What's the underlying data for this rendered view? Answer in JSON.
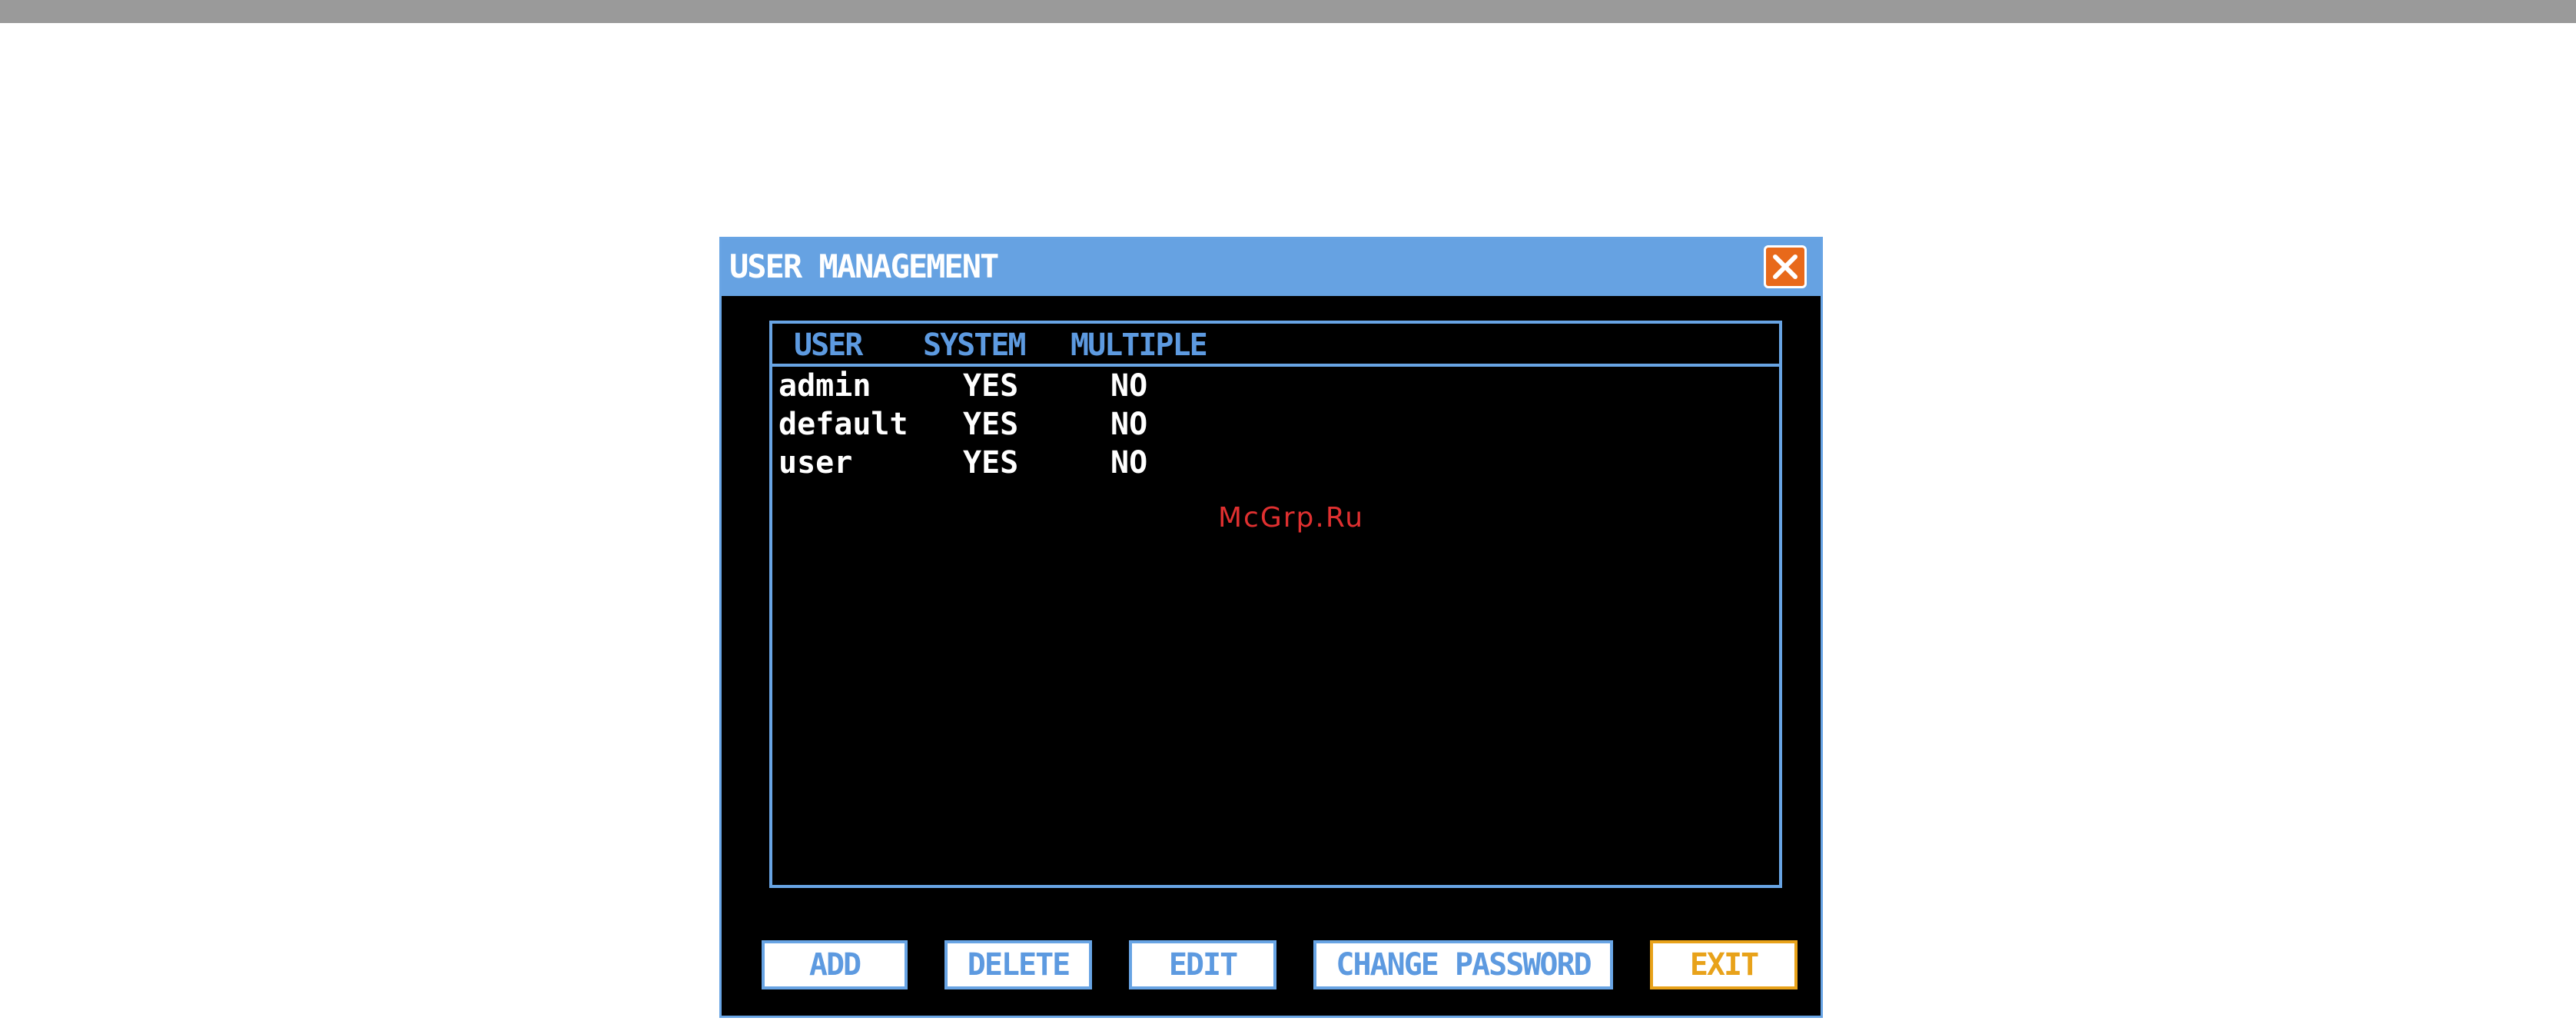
{
  "dialog": {
    "title": "USER MANAGEMENT"
  },
  "table": {
    "headers": {
      "user": "USER",
      "system": "SYSTEM",
      "multiple": "MULTIPLE"
    },
    "rows": [
      {
        "user": "admin",
        "system": "YES",
        "multiple": "NO"
      },
      {
        "user": "default",
        "system": "YES",
        "multiple": "NO"
      },
      {
        "user": "user",
        "system": "YES",
        "multiple": "NO"
      }
    ]
  },
  "watermark": "McGrp.Ru",
  "buttons": {
    "add": "ADD",
    "delete": "DELETE",
    "edit": "EDIT",
    "change_password": "CHANGE PASSWORD",
    "exit": "EXIT"
  },
  "icons": {
    "close": "close-icon"
  },
  "colors": {
    "accent": "#68a4e4",
    "exit": "#e8a21a",
    "close": "#e8691a"
  }
}
